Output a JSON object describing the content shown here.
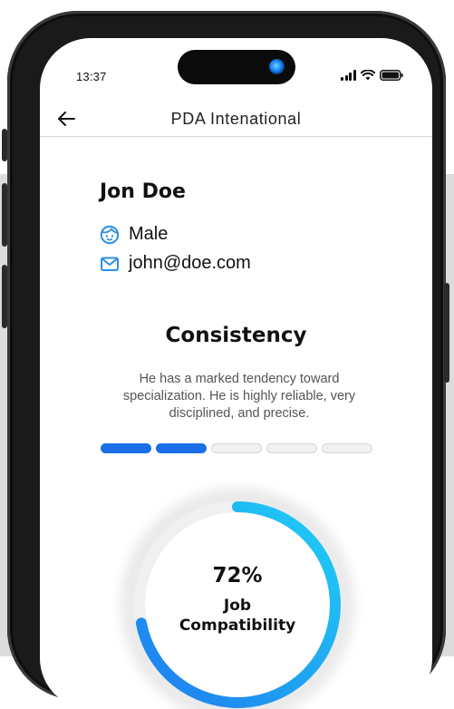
{
  "status_bar": {
    "time": "13:37",
    "icons": [
      "signal-icon",
      "wifi-icon",
      "battery-icon"
    ]
  },
  "nav": {
    "back_icon": "arrow-left-icon",
    "title": "PDA Intenational"
  },
  "profile": {
    "name": "Jon Doe",
    "gender": "Male",
    "gender_icon": "face-icon",
    "email": "john@doe.com",
    "email_icon": "mail-icon"
  },
  "trait": {
    "title": "Consistency",
    "description": "He has a marked tendency toward specialization. He is highly reliable, very disciplined, and precise.",
    "level_filled": 2,
    "level_total": 5
  },
  "compatibility": {
    "value": 0.72,
    "percent_text": "72%",
    "label_line1": "Job",
    "label_line2": "Compatibility"
  },
  "colors": {
    "accent_blue": "#1a6fe6",
    "gauge_start": "#1f7cf0",
    "gauge_end": "#1fd0f5",
    "icon_blue": "#2b8fe8"
  }
}
